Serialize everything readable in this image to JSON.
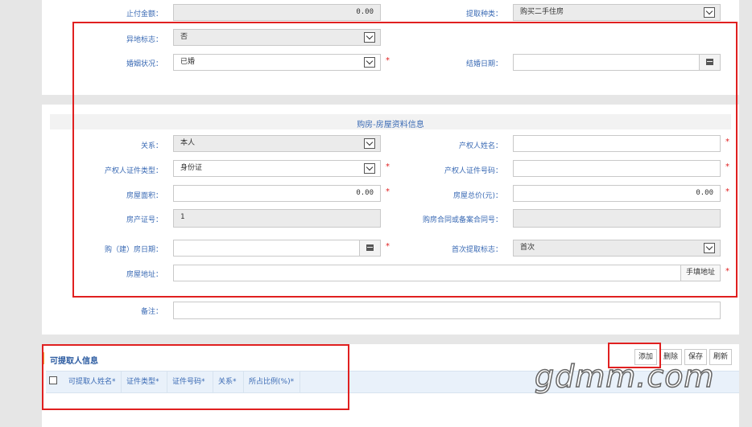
{
  "form": {
    "top": {
      "zhifu_label": "止付金额：",
      "zhifu_value": "0.00",
      "tiqu_type_label": "提取种类：",
      "tiqu_type_value": "购买二手住房",
      "yidi_label": "异地标志：",
      "yidi_value": "否",
      "hunyin_label": "婚姻状况：",
      "hunyin_value": "已婚",
      "jiehun_label": "结婚日期："
    },
    "house": {
      "section_title": "购房-房屋资料信息",
      "guanxi_label": "关系：",
      "guanxi_value": "本人",
      "owner_name_label": "产权人姓名：",
      "id_type_label": "产权人证件类型：",
      "id_type_value": "身份证",
      "id_no_label": "产权人证件号码：",
      "area_label": "房屋面积：",
      "area_value": "0.00",
      "total_price_label": "房屋总价(元)：",
      "total_price_value": "0.00",
      "cert_no_label": "房产证号：",
      "cert_no_value": "1",
      "contract_label": "购房合同或备案合同号：",
      "buy_date_label": "购（建）房日期：",
      "first_flag_label": "首次提取标志：",
      "first_flag_value": "首次",
      "address_label": "房屋地址：",
      "address_button": "手填地址",
      "remark_label": "备注："
    }
  },
  "extractors": {
    "title": "可提取人信息",
    "buttons": {
      "add": "添加",
      "delete": "删除",
      "save": "保存",
      "refresh": "刷新"
    },
    "columns": [
      "可提取人姓名*",
      "证件类型*",
      "证件号码*",
      "关系*",
      "所占比例(%)*"
    ]
  },
  "required_mark": "*",
  "watermark": "gdmm.com",
  "colors": {
    "label": "#3a6ab4",
    "required": "#e02020",
    "highlight_box": "#e02020"
  }
}
